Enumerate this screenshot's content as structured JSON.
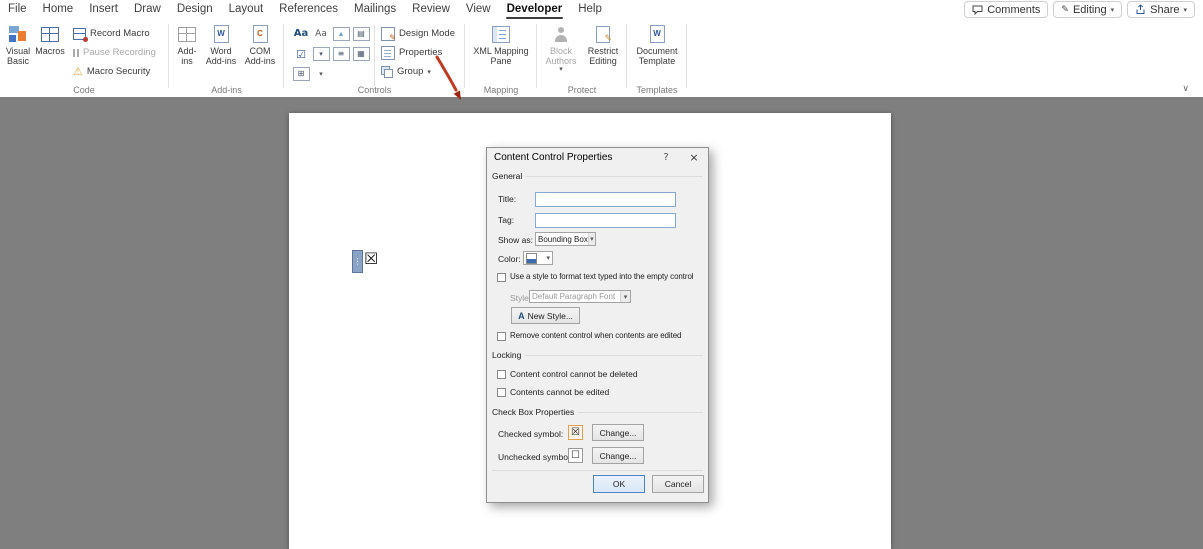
{
  "colors": {
    "canvas_background": "#7f7f7f",
    "annotation_arrow": "#bf3a1e",
    "default_button_accent": "#4d84c4"
  },
  "glyphs": {
    "dropdown": "▾",
    "collapse_ribbon": "∨",
    "warning": "⚠",
    "pencil": "✎",
    "dots": "⋮",
    "aa_rich": "Aa",
    "aa_plain": "Aa",
    "checkbox_control": "☑",
    "lines": "≡",
    "calendar": "▦",
    "gallery": "▤",
    "picture_triangle": "▴",
    "legacy_grid": "⊞",
    "help": "?",
    "close": "×"
  },
  "menu": {
    "tabs": [
      "File",
      "Home",
      "Insert",
      "Draw",
      "Design",
      "Layout",
      "References",
      "Mailings",
      "Review",
      "View",
      "Developer",
      "Help"
    ],
    "active_tab": "Developer",
    "comments_label": "Comments",
    "editing_label": "Editing",
    "share_label": "Share"
  },
  "ribbon": {
    "code": {
      "group_label": "Code",
      "visual_basic": "Visual Basic",
      "macros": "Macros",
      "record_macro": "Record Macro",
      "pause_recording": "Pause Recording",
      "macro_security": "Macro Security"
    },
    "addins": {
      "group_label": "Add-ins",
      "addins": "Add-ins",
      "word_addins": "Word Add-ins",
      "com_addins": "COM Add-ins"
    },
    "controls": {
      "group_label": "Controls",
      "design_mode": "Design Mode",
      "properties": "Properties",
      "group_button": "Group"
    },
    "mapping": {
      "group_label": "Mapping",
      "xml_mapping_pane": "XML Mapping Pane"
    },
    "protect": {
      "group_label": "Protect",
      "block_authors": "Block Authors",
      "restrict_editing": "Restrict Editing"
    },
    "templates": {
      "group_label": "Templates",
      "document_template": "Document Template"
    }
  },
  "dialog": {
    "title": "Content Control Properties",
    "general_section": "General",
    "title_label": "Title:",
    "title_value": "",
    "tag_label": "Tag:",
    "tag_value": "",
    "show_as_label": "Show as:",
    "show_as_value": "Bounding Box",
    "color_label": "Color:",
    "use_style_label": "Use a style to format text typed into the empty control",
    "style_label": "Style:",
    "style_value": "Default Paragraph Font",
    "new_style_button": "New Style...",
    "remove_label": "Remove content control when contents are edited",
    "locking_section": "Locking",
    "cannot_delete_label": "Content control cannot be deleted",
    "cannot_edit_label": "Contents cannot be edited",
    "checkbox_section": "Check Box Properties",
    "checked_symbol_label": "Checked symbol:",
    "checked_symbol": "☒",
    "unchecked_symbol_label": "Unchecked symbol:",
    "unchecked_symbol": "☐",
    "change_button": "Change...",
    "ok_button": "OK",
    "cancel_button": "Cancel"
  },
  "page": {
    "checkbox_glyph": "☒"
  }
}
